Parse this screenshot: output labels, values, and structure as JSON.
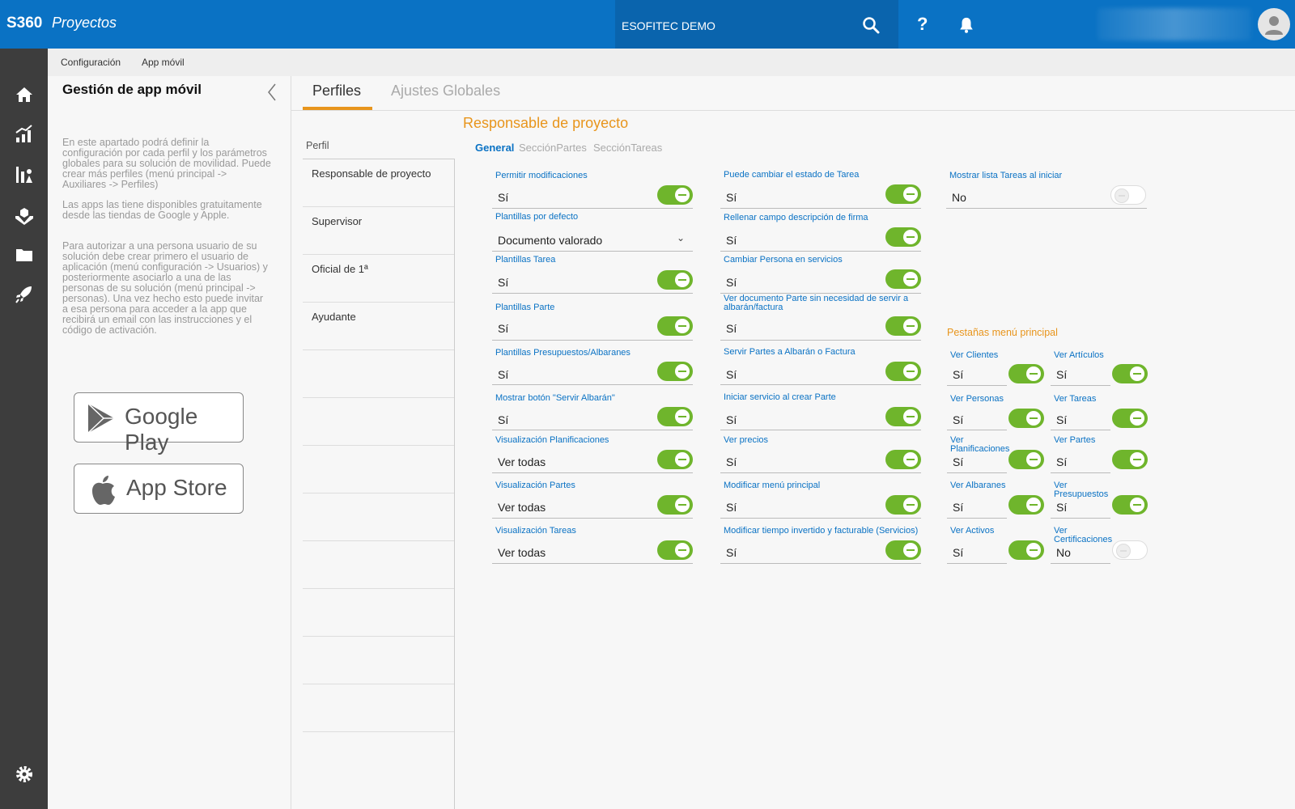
{
  "topbar": {
    "brand": "S360",
    "app_name": "Proyectos",
    "company": "ESOFITEC DEMO",
    "help": "?"
  },
  "breadcrumb": {
    "items": [
      "Configuración",
      "App móvil"
    ]
  },
  "info_panel": {
    "title": "Gestión de app móvil",
    "paragraph_1": "En este apartado podrá definir la configuración por cada perfil y los parámetros globales para su solución de movilidad. Puede crear más perfiles (menú principal -> Auxiliares -> Perfiles)",
    "paragraph_2": "Las apps las tiene disponibles gratuitamente desde las tiendas de Google y Apple.",
    "paragraph_3": "Para autorizar a una persona usuario de su solución debe crear primero el usuario de aplicación (menú configuración -> Usuarios) y posteriormente asociarlo a una de las personas de su solución (menú principal -> personas). Una vez hecho esto puede invitar a esa persona para acceder a la app que recibirá un email con las instrucciones y el código de activación.",
    "google_play": "Google Play",
    "app_store": "App Store"
  },
  "tabs": {
    "perfiles": "Perfiles",
    "ajustes": "Ajustes Globales"
  },
  "profiles": {
    "header": "Perfil",
    "items": [
      "Responsable de proyecto",
      "Supervisor",
      "Oficial de 1ª",
      "Ayudante"
    ]
  },
  "form": {
    "title": "Responsable de proyecto",
    "subtabs": [
      "General",
      "SecciónPartes",
      "SecciónTareas"
    ],
    "col1": [
      {
        "label": "Permitir modificaciones",
        "value": "Sí",
        "on": true
      },
      {
        "label": "Plantillas por defecto",
        "value": "Documento valorado"
      },
      {
        "label": "Plantillas Tarea",
        "value": "Sí",
        "on": true
      },
      {
        "label": "Plantillas Parte",
        "value": "Sí",
        "on": true
      },
      {
        "label": "Plantillas Presupuestos/Albaranes",
        "value": "Sí",
        "on": true
      },
      {
        "label": "Mostrar botón \"Servir Albarán\"",
        "value": "Sí",
        "on": true
      },
      {
        "label": "Visualización Planificaciones",
        "value": "Ver todas",
        "on": true
      },
      {
        "label": "Visualización Partes",
        "value": "Ver todas",
        "on": true
      },
      {
        "label": "Visualización Tareas",
        "value": "Ver todas",
        "on": true
      }
    ],
    "col2": [
      {
        "label": "Puede cambiar el estado de Tarea",
        "value": "Sí",
        "on": true
      },
      {
        "label": "Rellenar campo descripción de firma",
        "value": "Sí",
        "on": true
      },
      {
        "label": "Cambiar Persona en servicios",
        "value": "Sí",
        "on": true
      },
      {
        "label": "Ver documento Parte sin necesidad de servir a albarán/factura",
        "value": "Sí",
        "on": true
      },
      {
        "label": "Servir Partes a Albarán o Factura",
        "value": "Sí",
        "on": true
      },
      {
        "label": "Iniciar servicio al crear Parte",
        "value": "Sí",
        "on": true
      },
      {
        "label": "Ver precios",
        "value": "Sí",
        "on": true
      },
      {
        "label": "Modificar menú principal",
        "value": "Sí",
        "on": true
      },
      {
        "label": "Modificar tiempo invertido y facturable (Servicios)",
        "value": "Sí",
        "on": true
      }
    ],
    "col3_top": {
      "label": "Mostrar lista Tareas al iniciar",
      "value": "No",
      "on": false
    },
    "menu_tabs_title": "Pestañas menú principal",
    "menu_tabs": [
      {
        "label": "Ver Clientes",
        "value": "Sí",
        "on": true
      },
      {
        "label": "Ver Artículos",
        "value": "Sí",
        "on": true
      },
      {
        "label": "Ver Personas",
        "value": "Sí",
        "on": true
      },
      {
        "label": "Ver Tareas",
        "value": "Sí",
        "on": true
      },
      {
        "label": "Ver Planificaciones",
        "value": "Sí",
        "on": true
      },
      {
        "label": "Ver Partes",
        "value": "Sí",
        "on": true
      },
      {
        "label": "Ver Albaranes",
        "value": "Sí",
        "on": true
      },
      {
        "label": "Ver Presupuestos",
        "value": "Sí",
        "on": true
      },
      {
        "label": "Ver Activos",
        "value": "Sí",
        "on": true
      },
      {
        "label": "Ver Certificaciones",
        "value": "No",
        "on": false
      }
    ]
  },
  "colors": {
    "brand_blue": "#0a72c4",
    "accent_orange": "#e8951c",
    "toggle_green": "#6fb52c",
    "rail_dark": "#3d3d3d"
  },
  "icons": [
    "search-icon",
    "help-icon",
    "bell-icon",
    "avatar-icon",
    "home-icon",
    "chart-icon",
    "tasks-icon",
    "hands-icon",
    "folder-icon",
    "rocket-icon",
    "settings-icon",
    "chevron-left-icon",
    "google-play-icon",
    "apple-icon",
    "chevron-down-icon"
  ]
}
